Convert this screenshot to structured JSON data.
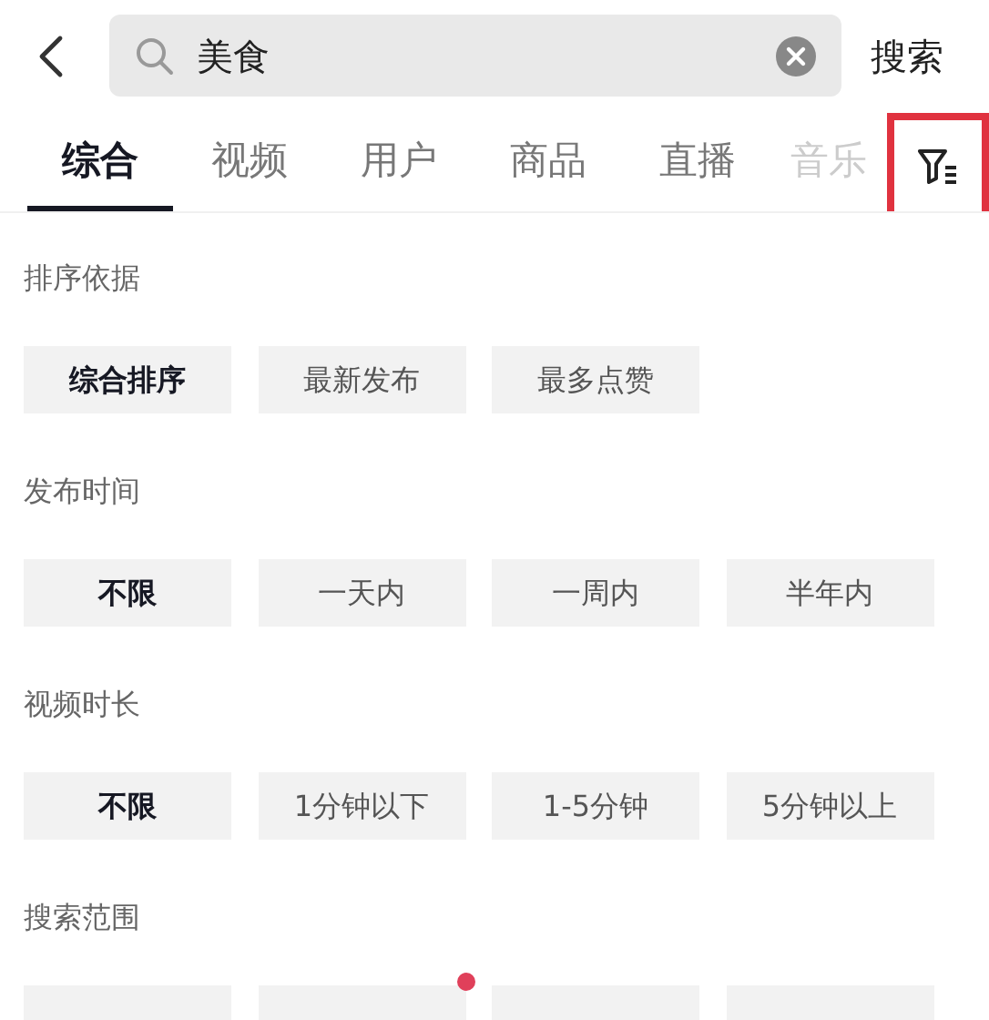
{
  "search": {
    "value": "美食",
    "submit": "搜索"
  },
  "tabs": [
    {
      "label": "综合",
      "selected": true,
      "faded": false
    },
    {
      "label": "视频",
      "selected": false,
      "faded": false
    },
    {
      "label": "用户",
      "selected": false,
      "faded": false
    },
    {
      "label": "商品",
      "selected": false,
      "faded": false
    },
    {
      "label": "直播",
      "selected": false,
      "faded": false
    },
    {
      "label": "音乐",
      "selected": false,
      "faded": true
    }
  ],
  "filter_button": {
    "highlighted": true
  },
  "sections": [
    {
      "title": "排序依据",
      "options": [
        {
          "label": "综合排序",
          "selected": true,
          "dot": false
        },
        {
          "label": "最新发布",
          "selected": false,
          "dot": false
        },
        {
          "label": "最多点赞",
          "selected": false,
          "dot": false
        }
      ]
    },
    {
      "title": "发布时间",
      "options": [
        {
          "label": "不限",
          "selected": true,
          "dot": false
        },
        {
          "label": "一天内",
          "selected": false,
          "dot": false
        },
        {
          "label": "一周内",
          "selected": false,
          "dot": false
        },
        {
          "label": "半年内",
          "selected": false,
          "dot": false
        }
      ]
    },
    {
      "title": "视频时长",
      "options": [
        {
          "label": "不限",
          "selected": true,
          "dot": false
        },
        {
          "label": "1分钟以下",
          "selected": false,
          "dot": false
        },
        {
          "label": "1-5分钟",
          "selected": false,
          "dot": false
        },
        {
          "label": "5分钟以上",
          "selected": false,
          "dot": false
        }
      ]
    },
    {
      "title": "搜索范围",
      "options": [
        {
          "dot": false
        },
        {
          "dot": true
        },
        {
          "dot": false
        },
        {
          "dot": false
        }
      ]
    }
  ]
}
